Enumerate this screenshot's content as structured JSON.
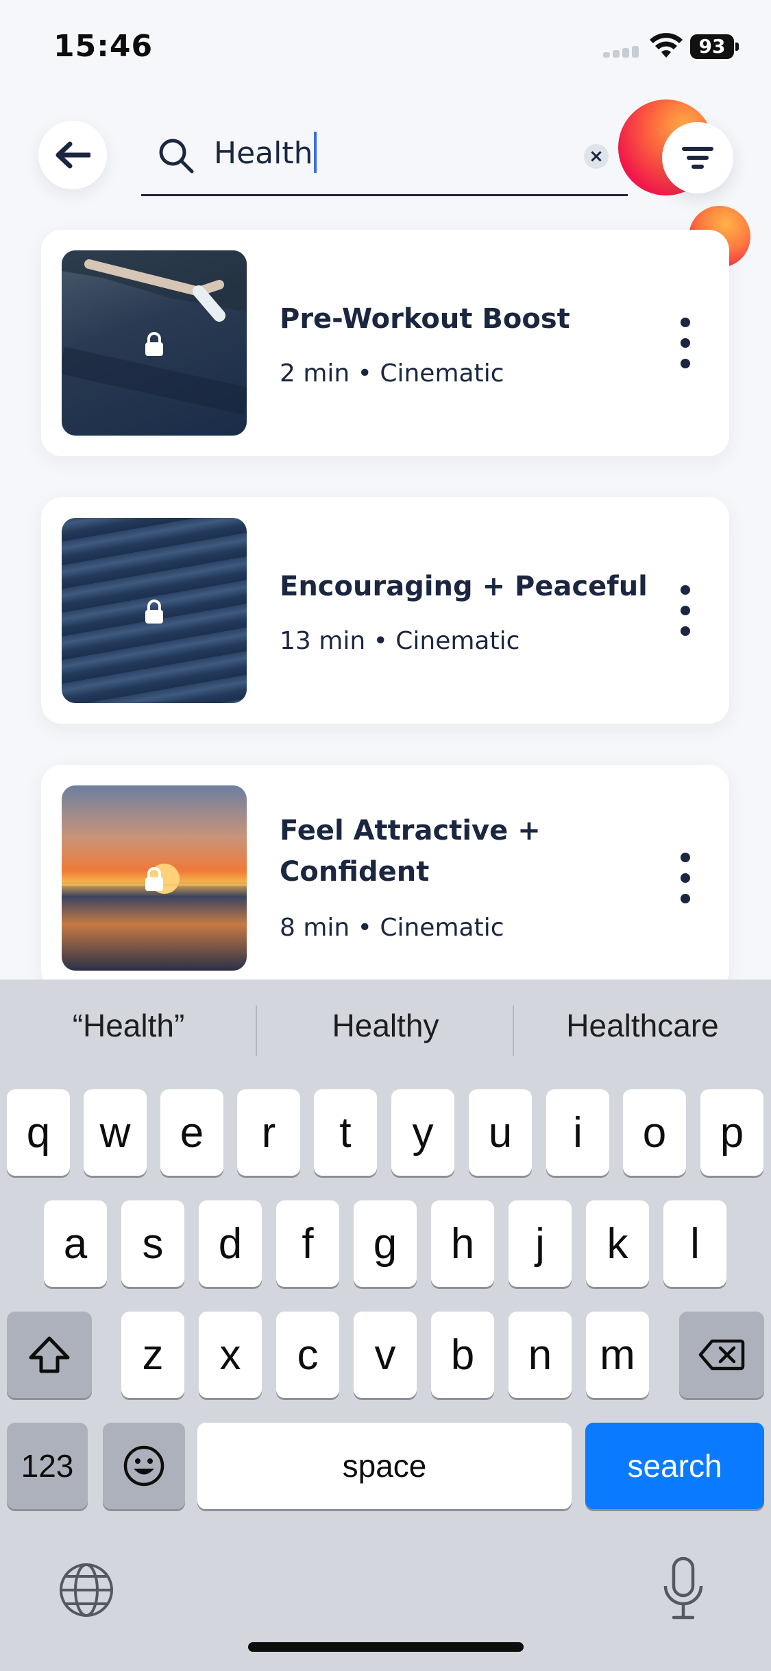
{
  "status_bar": {
    "time": "15:46",
    "battery": "93"
  },
  "search": {
    "query": "Health",
    "clear_label": "×"
  },
  "results": [
    {
      "title": "Pre-Workout Boost",
      "meta": "2 min • Cinematic"
    },
    {
      "title": "Encouraging + Peaceful",
      "meta": "13 min • Cinematic"
    },
    {
      "title": "Feel Attractive + Confident",
      "meta": "8 min • Cinematic"
    }
  ],
  "keyboard": {
    "suggestions": [
      "“Health”",
      "Healthy",
      "Healthcare"
    ],
    "row1": [
      "q",
      "w",
      "e",
      "r",
      "t",
      "y",
      "u",
      "i",
      "o",
      "p"
    ],
    "row2": [
      "a",
      "s",
      "d",
      "f",
      "g",
      "h",
      "j",
      "k",
      "l"
    ],
    "row3": [
      "z",
      "x",
      "c",
      "v",
      "b",
      "n",
      "m"
    ],
    "numbers_label": "123",
    "space_label": "space",
    "search_label": "search"
  },
  "icons": {
    "back": "arrow-left-icon",
    "search": "search-icon",
    "filter": "filter-icon",
    "more": "more-vertical-icon",
    "lock": "lock-icon",
    "shift": "shift-icon",
    "delete": "backspace-icon",
    "emoji": "emoji-icon",
    "globe": "globe-icon",
    "mic": "microphone-icon"
  },
  "colors": {
    "text": "#1b2640",
    "search_key": "#0a7aff",
    "keyboard_bg": "#d3d6dd",
    "accent_orb": "#f0184a"
  }
}
